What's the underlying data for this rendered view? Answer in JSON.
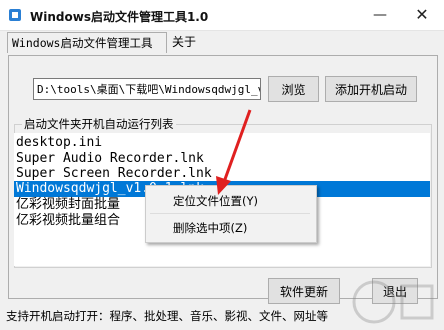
{
  "window": {
    "title": "Windows启动文件管理工具1.0",
    "minimize": "—",
    "close": "✕"
  },
  "tabs": {
    "main": "Windows启动文件管理工具",
    "about": "关于"
  },
  "path_input": {
    "value": "D:\\tools\\桌面\\下载吧\\Windowsqdwjgl_v1"
  },
  "buttons": {
    "browse": "浏览",
    "add_startup": "添加开机启动",
    "update": "软件更新",
    "exit": "退出"
  },
  "list": {
    "label": "启动文件夹开机自动运行列表",
    "items": [
      "desktop.ini",
      "Super Audio Recorder.lnk",
      "Super Screen Recorder.lnk",
      "Windowsqdwjgl_v1.0.1.lnk",
      "亿彩视频封面批量",
      "亿彩视频批量组合"
    ]
  },
  "context_menu": {
    "locate": "定位文件位置(Y)",
    "delete": "删除选中项(Z)"
  },
  "status": "支持开机启动打开：程序、批处理、音乐、影视、文件、网址等",
  "colors": {
    "selection": "#0078d7",
    "arrow": "#e02020"
  }
}
